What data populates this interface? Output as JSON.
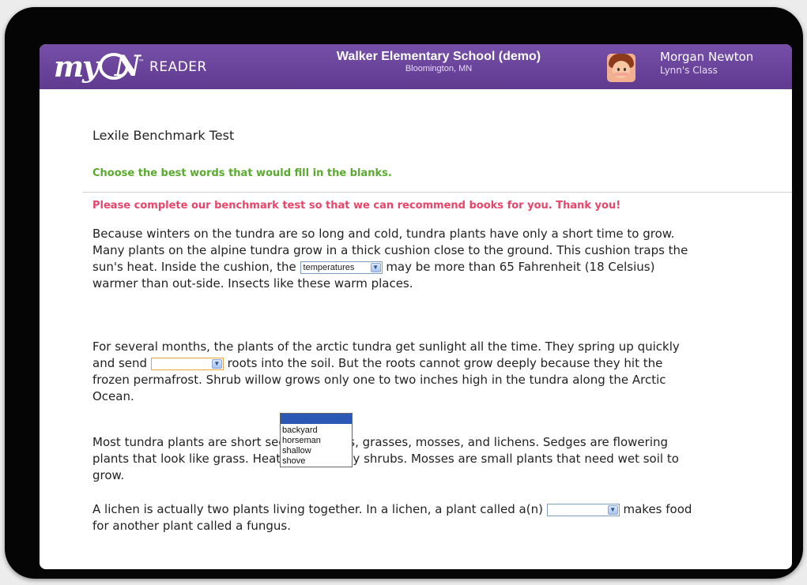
{
  "header": {
    "logo_prefix": "my",
    "logo_suffix": "N",
    "logo_tm": "™",
    "app_name": "READER",
    "school_name": "Walker Elementary School (demo)",
    "school_location": "Bloomington, MN",
    "user_name": "Morgan Newton",
    "user_class": "Lynn's Class"
  },
  "test": {
    "title": "Lexile Benchmark Test",
    "instruction": "Choose the best words that would fill in the blanks.",
    "notice": "Please complete our benchmark test so that we can recommend books for you. Thank you!"
  },
  "passage": {
    "p1_a": "Because winters on the tundra are so long and cold, tundra plants have only a short time to grow. Many plants on the alpine tundra grow in a thick cushion close to the ground. This cushion traps the sun's heat. Inside the cushion, the ",
    "p1_select": "temperatures",
    "p1_b": " may be more than 65 Fahrenheit (18 Celsius) warmer than out-side. Insects like these warm places.",
    "p2_a": "For several months, the plants of the arctic tundra get sunlight all the time. They spring up quickly and send ",
    "p2_select": "",
    "p2_b": " roots into the soil. But the roots cannot grow deeply because they hit the frozen permafrost. Shrub willow grows only one to two inches high in the tundra along the Arctic Ocean.",
    "p3": "Most tundra plants are short sedges, heaths, grasses, mosses, and lichens. Sedges are flowering plants that look like grass. Heaths are woody shrubs. Mosses are small plants that need wet soil to grow.",
    "p4_a": "A lichen is actually two plants living together. In a lichen, a plant called a(n) ",
    "p4_select": "",
    "p4_b": " makes food for another plant called a fungus."
  },
  "dropdown": {
    "options": [
      "backyard",
      "horseman",
      "shallow",
      "shove"
    ]
  },
  "icons": {
    "select_arrow": "chevron-down-icon"
  },
  "colors": {
    "header": "#6a449c",
    "instruction": "#5aaa2f",
    "notice": "#e9456a",
    "highlight": "#2b58b4"
  }
}
